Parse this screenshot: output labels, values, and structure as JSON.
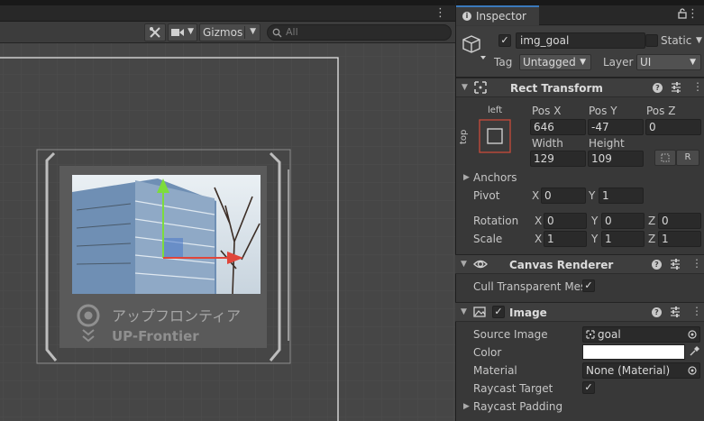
{
  "scene": {
    "toolbar": {
      "gizmos_label": "Gizmos",
      "search_placeholder": "All"
    },
    "sprite": {
      "title_jp": "アップフロンティア",
      "title_en": "UP-Frontier"
    }
  },
  "inspector": {
    "tab_label": "Inspector",
    "gameobject": {
      "name": "img_goal",
      "active": true,
      "static_label": "Static",
      "tag_label": "Tag",
      "tag_value": "Untagged",
      "layer_label": "Layer",
      "layer_value": "UI"
    },
    "rect_transform": {
      "title": "Rect Transform",
      "anchor_h": "left",
      "anchor_v": "top",
      "pos_x_label": "Pos X",
      "pos_y_label": "Pos Y",
      "pos_z_label": "Pos Z",
      "pos_x": "646",
      "pos_y": "-47",
      "pos_z": "0",
      "width_label": "Width",
      "height_label": "Height",
      "width": "129",
      "height": "109",
      "raw_btn": "R",
      "anchors_label": "Anchors",
      "pivot_label": "Pivot",
      "pivot_x": "0",
      "pivot_y": "1",
      "rotation_label": "Rotation",
      "rot_x": "0",
      "rot_y": "0",
      "rot_z": "0",
      "scale_label": "Scale",
      "scale_x": "1",
      "scale_y": "1",
      "scale_z": "1",
      "axis_x": "X",
      "axis_y": "Y",
      "axis_z": "Z"
    },
    "canvas_renderer": {
      "title": "Canvas Renderer",
      "cull_label": "Cull Transparent Mes",
      "cull_checked": true
    },
    "image": {
      "title": "Image",
      "enabled": true,
      "source_label": "Source Image",
      "source_value": "goal",
      "color_label": "Color",
      "color_value": "#ffffff",
      "material_label": "Material",
      "material_value": "None (Material)",
      "raycast_target_label": "Raycast Target",
      "raycast_target_checked": true,
      "raycast_padding_label": "Raycast Padding"
    }
  },
  "colors": {
    "accent_blue": "#3a79bb",
    "gizmo_x": "#e0453a",
    "gizmo_y": "#7ddc3c"
  }
}
